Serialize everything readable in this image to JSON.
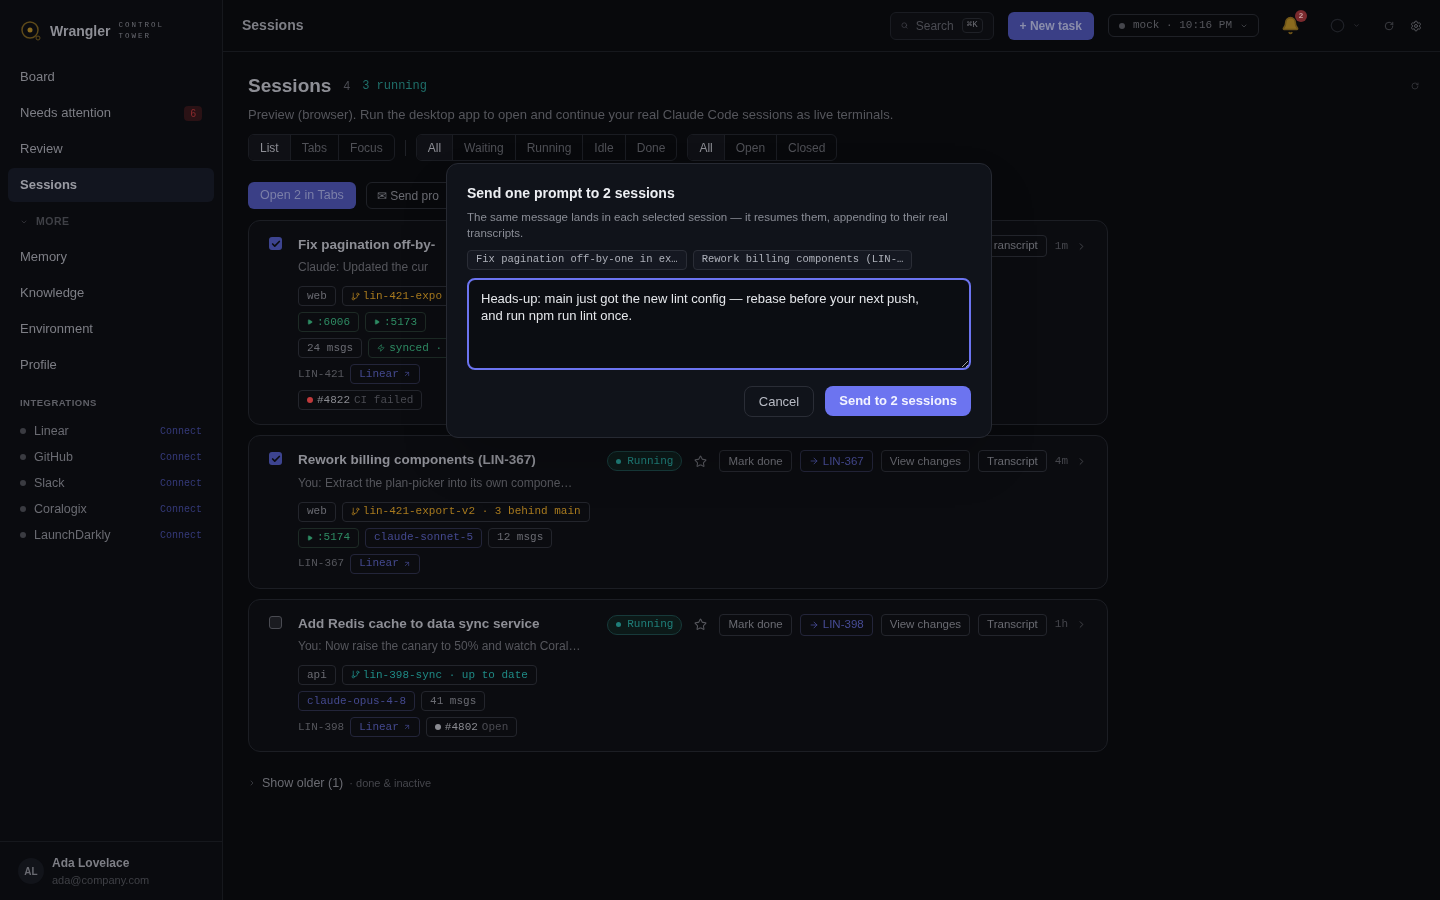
{
  "brand": {
    "name": "Wrangler",
    "tagline": "CONTROL TOWER"
  },
  "sidebar": {
    "items": [
      {
        "label": "Board",
        "selected": false
      },
      {
        "label": "Needs attention",
        "selected": false,
        "badge": "6"
      },
      {
        "label": "Review",
        "selected": false
      },
      {
        "label": "Sessions",
        "selected": true
      }
    ],
    "more": {
      "label": "MORE",
      "expanded": true,
      "items": [
        {
          "label": "Memory",
          "selected": false
        },
        {
          "label": "Knowledge",
          "selected": false
        },
        {
          "label": "Environment",
          "selected": false
        },
        {
          "label": "Profile",
          "selected": false
        }
      ]
    },
    "integrations_title": "INTEGRATIONS",
    "integrations": [
      {
        "name": "Linear",
        "action": "Connect"
      },
      {
        "name": "GitHub",
        "action": "Connect"
      },
      {
        "name": "Slack",
        "action": "Connect"
      },
      {
        "name": "Coralogix",
        "action": "Connect"
      },
      {
        "name": "LaunchDarkly",
        "action": "Connect"
      }
    ],
    "user": {
      "initials": "AL",
      "name": "Ada Lovelace",
      "email": "ada@company.com"
    }
  },
  "header": {
    "title": "Sessions",
    "search": {
      "placeholder": "Search",
      "shortcut": "⌘K"
    },
    "new_task": "+ New task",
    "env": {
      "label": "mock · 10:16 PM"
    },
    "notifications": {
      "count": "2"
    }
  },
  "page": {
    "title": "Sessions",
    "count": "4",
    "running": "3 running",
    "description": "Preview (browser). Run the desktop app to open and continue your real Claude Code sessions as live terminals.",
    "filter_groups": [
      [
        {
          "label": "List",
          "selected": true
        },
        {
          "label": "Tabs",
          "selected": false
        },
        {
          "label": "Focus",
          "selected": false
        }
      ],
      [
        {
          "label": "All",
          "selected": true
        },
        {
          "label": "Waiting",
          "selected": false
        },
        {
          "label": "Running",
          "selected": false
        },
        {
          "label": "Idle",
          "selected": false
        },
        {
          "label": "Done",
          "selected": false
        }
      ],
      [
        {
          "label": "All",
          "selected": true
        },
        {
          "label": "Open",
          "selected": false
        },
        {
          "label": "Closed",
          "selected": false
        }
      ]
    ],
    "actions": [
      {
        "label": "Open 2 in Tabs",
        "kind": "primary"
      },
      {
        "label": "✉ Send pro",
        "kind": "outline"
      }
    ]
  },
  "sessions": [
    {
      "selected": true,
      "title": "Fix pagination off-by-",
      "summary": "Claude: Updated the cur",
      "actions": [
        {
          "label": "ranscript",
          "kind": "plain"
        }
      ],
      "age": "1m",
      "chip_rows": [
        [
          {
            "kind": "repo",
            "text": "web"
          },
          {
            "kind": "branch",
            "text": "lin-421-expo",
            "color": "#a87a1e"
          }
        ],
        [
          {
            "kind": "port",
            "text": ":6006"
          },
          {
            "kind": "port",
            "text": ":5173"
          }
        ],
        [
          {
            "kind": "msgs",
            "text": "24 msgs"
          },
          {
            "kind": "sync",
            "text": "synced ·"
          }
        ],
        [
          {
            "kind": "id",
            "text": "LIN-421"
          },
          {
            "kind": "link",
            "text": "Linear"
          }
        ],
        [
          {
            "kind": "pr",
            "number": "#4822",
            "text": "CI failed",
            "color": "#c0393b"
          }
        ]
      ]
    },
    {
      "selected": true,
      "title": "Rework billing components (LIN-367)",
      "summary": "You: Extract the plan-picker into its own compone…",
      "status": "Running",
      "starred": false,
      "actions": [
        {
          "label": "Mark done",
          "kind": "plain"
        },
        {
          "label": "LIN-367",
          "kind": "link"
        },
        {
          "label": "View changes",
          "kind": "plain"
        },
        {
          "label": "Transcript",
          "kind": "plain"
        }
      ],
      "age": "4m",
      "chip_rows": [
        [
          {
            "kind": "repo",
            "text": "web"
          },
          {
            "kind": "branch",
            "text": "lin-421-export-v2 · 3 behind main",
            "color": "#a87a1e"
          }
        ],
        [
          {
            "kind": "port",
            "text": ":5174"
          },
          {
            "kind": "model",
            "text": "claude-sonnet-5"
          },
          {
            "kind": "msgs",
            "text": "12 msgs"
          }
        ],
        [
          {
            "kind": "id",
            "text": "LIN-367"
          },
          {
            "kind": "link",
            "text": "Linear"
          }
        ]
      ]
    },
    {
      "selected": false,
      "title": "Add Redis cache to data sync service",
      "summary": "You: Now raise the canary to 50% and watch Coral…",
      "status": "Running",
      "starred": false,
      "actions": [
        {
          "label": "Mark done",
          "kind": "plain"
        },
        {
          "label": "LIN-398",
          "kind": "link"
        },
        {
          "label": "View changes",
          "kind": "plain"
        },
        {
          "label": "Transcript",
          "kind": "plain"
        }
      ],
      "age": "1h",
      "chip_rows": [
        [
          {
            "kind": "repo",
            "text": "api"
          },
          {
            "kind": "branch",
            "text": "lin-398-sync · up to date",
            "color": "#1f8a85"
          }
        ],
        [
          {
            "kind": "model",
            "text": "claude-opus-4-8"
          },
          {
            "kind": "msgs",
            "text": "41 msgs"
          }
        ],
        [
          {
            "kind": "id",
            "text": "LIN-398"
          },
          {
            "kind": "link",
            "text": "Linear"
          },
          {
            "kind": "pr",
            "number": "#4802",
            "text": "Open",
            "color": "#8a8b91"
          }
        ]
      ]
    }
  ],
  "show_older": {
    "label": "Show older (1)",
    "note": "· done & inactive",
    "expanded": false
  },
  "modal": {
    "title": "Send one prompt to 2 sessions",
    "description": "The same message lands in each selected session — it resumes them, appending to their real transcripts.",
    "targets": [
      "Fix pagination off-by-one in ex…",
      "Rework billing components (LIN-…"
    ],
    "message": "Heads-up: main just got the new lint config — rebase before your next push, and run npm run lint once.",
    "cancel": "Cancel",
    "submit": "Send to 2 sessions"
  }
}
